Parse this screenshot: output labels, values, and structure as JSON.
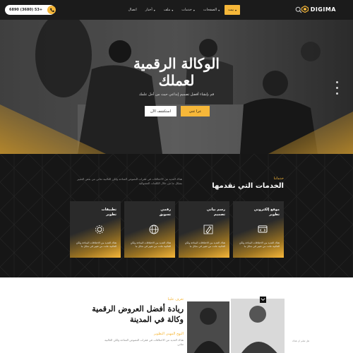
{
  "header": {
    "logo_text": "DIGIMA",
    "phone": "6890 (3680) 53+",
    "nav": [
      {
        "label": "بيت",
        "active": true,
        "dropdown": true
      },
      {
        "label": "الصفحات",
        "active": false,
        "dropdown": true
      },
      {
        "label": "خدمات",
        "active": false,
        "dropdown": true
      },
      {
        "label": "ملف",
        "active": false,
        "dropdown": true
      },
      {
        "label": "أخبار",
        "active": false,
        "dropdown": true
      },
      {
        "label": "اتصال",
        "active": false,
        "dropdown": false
      }
    ]
  },
  "hero": {
    "title_line1": "الوكالة الرقمية",
    "title_line2": "لعملك",
    "subtitle": "قم بإنشاء أفضل تصميم إبداعي حيث من أجل علمك",
    "primary_label": "عرا عنى",
    "secondary_label": "استكشف الآن"
  },
  "services": {
    "tag": "خدماتنا",
    "title": "الخدمات التي نقدمها",
    "description": "هناك العديد من الاختلافات في فقرات النصوص المتاحة ولكن الغالبية تعاني من بعض التغيير بشكل ما من خلال الكلمات العشوائية",
    "cards": [
      {
        "title_line1": "موقع إلكتروني",
        "title_line2": "تطوير",
        "desc": "هناك العديد من الاختلافات المتاحة ولكن الغالبية عانت من تغيير في شكل ما",
        "icon": "web-code-icon"
      },
      {
        "title_line1": "رسم بياني",
        "title_line2": "تصميم",
        "desc": "هناك العديد من الاختلافات المتاحة ولكن الغالبية عانت من تغيير في شكل ما",
        "icon": "design-pen-icon"
      },
      {
        "title_line1": "رقمي",
        "title_line2": "تسويق",
        "desc": "هناك العديد من الاختلافات المتاحة ولكن الغالبية عانت من تغيير في شكل ما",
        "icon": "globe-icon"
      },
      {
        "title_line1": "تطبيقات",
        "title_line2": "تطوير",
        "desc": "هناك العديد من الاختلافات المتاحة ولكن الغالبية عانت من تغيير في شكل ما",
        "icon": "gear-cog-icon"
      }
    ]
  },
  "lead": {
    "tag": "تعرف علينا",
    "title_line1": "ريادة أفضل العروض الرقمية",
    "title_line2": "وكالة في المدينة",
    "subtitle": "النهج المهني التطوير",
    "description": "هناك العديد من الاختلافات في فقرات النصوص المتاحة ولكن الغالبية تعاني",
    "note": "هل تعلم ان هناك"
  },
  "colors": {
    "accent": "#f6b739",
    "dark": "#161616"
  }
}
